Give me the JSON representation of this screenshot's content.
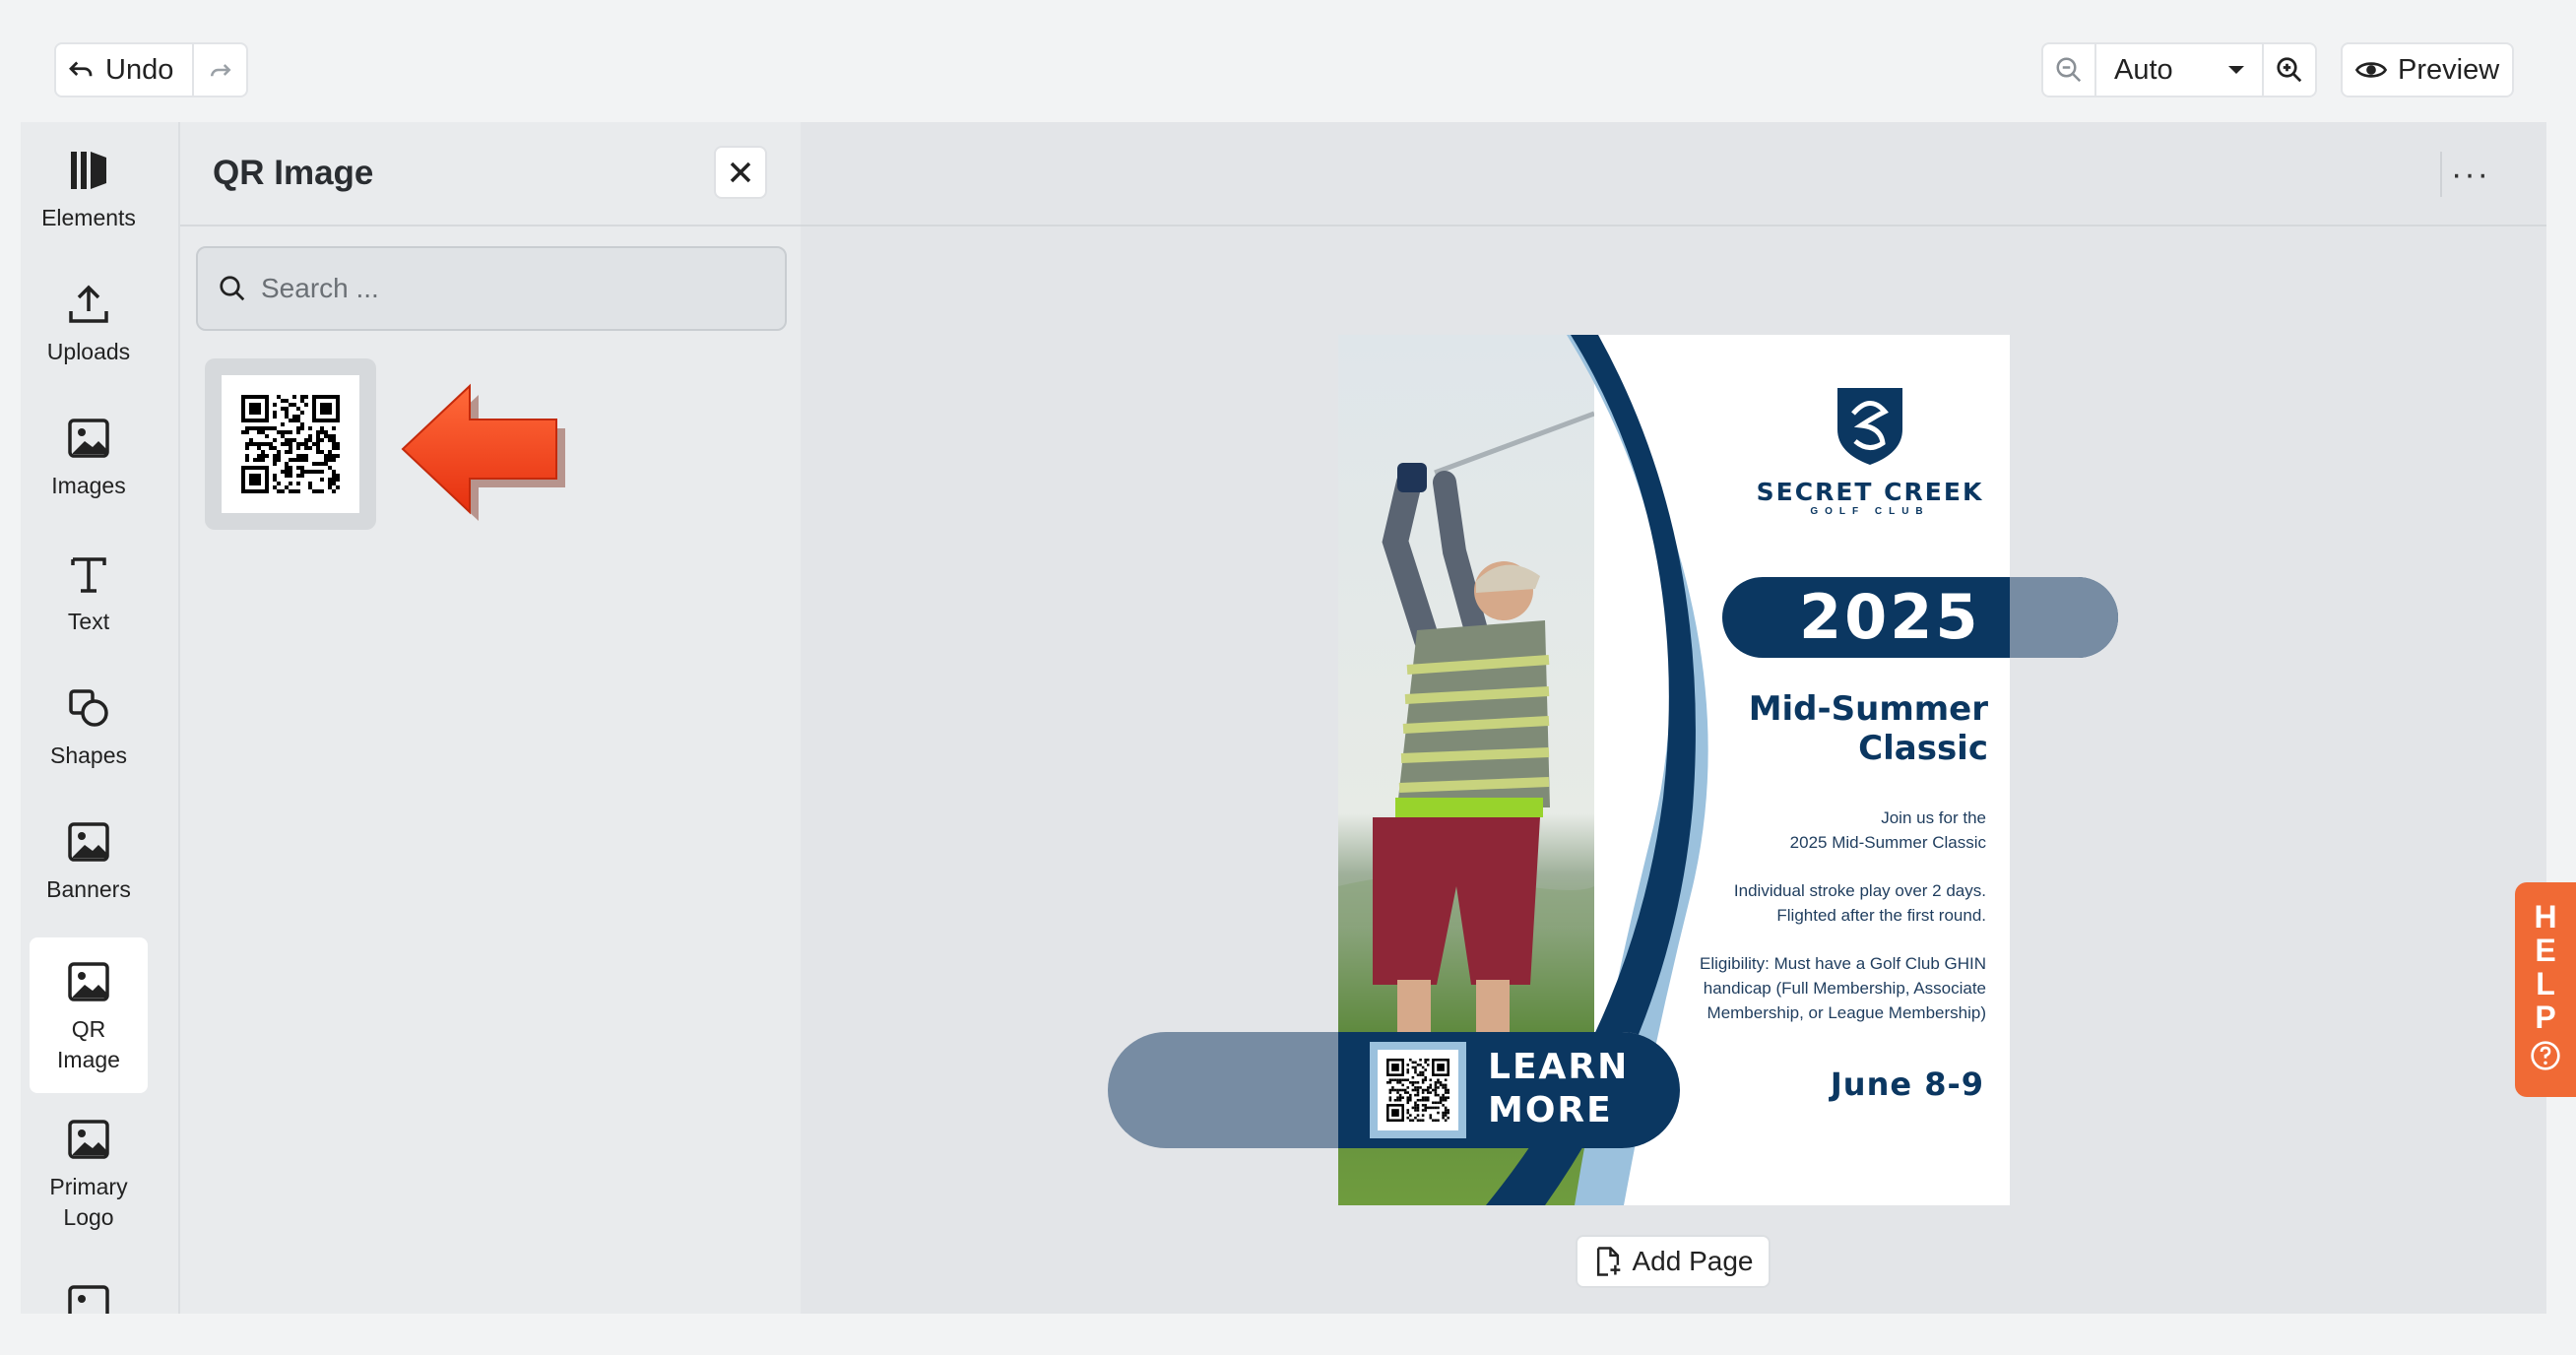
{
  "toolbar": {
    "undo_label": "Undo",
    "zoom_value": "Auto",
    "preview_label": "Preview"
  },
  "rail": {
    "items": [
      {
        "label": "Elements"
      },
      {
        "label": "Uploads"
      },
      {
        "label": "Images"
      },
      {
        "label": "Text"
      },
      {
        "label": "Shapes"
      },
      {
        "label": "Banners"
      },
      {
        "label": "QR Image"
      },
      {
        "label": "Primary Logo"
      }
    ]
  },
  "panel": {
    "title": "QR Image",
    "search_placeholder": "Search ..."
  },
  "flyer": {
    "brand_name": "SECRET CREEK",
    "brand_sub": "GOLF CLUB",
    "year": "2025",
    "event_line1": "Mid-Summer",
    "event_line2": "Classic",
    "blurb1_line1": "Join us for the",
    "blurb1_line2": "2025  Mid-Summer Classic",
    "blurb2_line1": "Individual stroke play over 2 days.",
    "blurb2_line2": "Flighted after the first round.",
    "blurb3_line1": "Eligibility: Must have a  Golf Club GHIN",
    "blurb3_line2": "handicap (Full Membership, Associate",
    "blurb3_line3": "Membership, or League Membership)",
    "cta_line1": "LEARN",
    "cta_line2": "MORE",
    "date": "June 8-9"
  },
  "canvas": {
    "add_page_label": "Add Page"
  },
  "help": {
    "letters": [
      "H",
      "E",
      "L",
      "P"
    ]
  },
  "colors": {
    "navy": "#0b3761",
    "slate": "#778ca3",
    "help_orange": "#f06a35",
    "arrow_red": "#f2421b"
  }
}
